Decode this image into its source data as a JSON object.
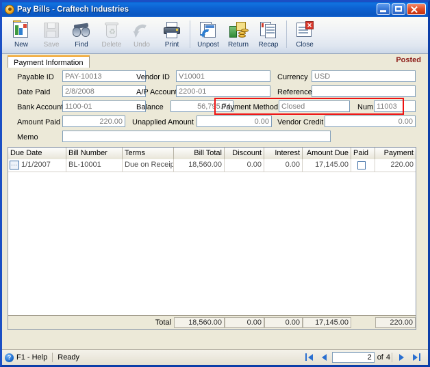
{
  "window": {
    "title": "Pay Bills - Craftech Industries",
    "icon": "app-icon",
    "caption_buttons": [
      "minimize",
      "maximize",
      "close"
    ]
  },
  "toolbar": {
    "items": [
      {
        "label": "New",
        "icon": "new-document-icon",
        "disabled": false
      },
      {
        "label": "Save",
        "icon": "save-floppy-icon",
        "disabled": true
      },
      {
        "label": "Find",
        "icon": "binoculars-icon",
        "disabled": false
      },
      {
        "label": "Delete",
        "icon": "recycle-bin-icon",
        "disabled": true
      },
      {
        "label": "Undo",
        "icon": "undo-arrow-icon",
        "disabled": true
      },
      {
        "label": "Print",
        "icon": "printer-icon",
        "disabled": false
      },
      {
        "label": "Unpost",
        "icon": "unpost-icon",
        "disabled": false
      },
      {
        "label": "Return",
        "icon": "return-money-icon",
        "disabled": false
      },
      {
        "label": "Recap",
        "icon": "recap-documents-icon",
        "disabled": false
      },
      {
        "label": "Close",
        "icon": "close-window-icon",
        "disabled": false
      }
    ]
  },
  "tabs": {
    "active": "Payment Information",
    "items": [
      "Payment Information"
    ]
  },
  "status_label": "Posted",
  "form": {
    "payable_id": {
      "label": "Payable ID",
      "value": "PAY-10013"
    },
    "date_paid": {
      "label": "Date Paid",
      "value": "2/8/2008"
    },
    "bank_account": {
      "label": "Bank Account",
      "value": "1100-01"
    },
    "amount_paid": {
      "label": "Amount Paid",
      "value": "220.00"
    },
    "memo": {
      "label": "Memo",
      "value": ""
    },
    "vendor_id": {
      "label": "Vendor ID",
      "value": "V10001"
    },
    "ap_account": {
      "label": "A/P Account",
      "value": "2200-01"
    },
    "balance": {
      "label": "Balance",
      "value": "56,795.74"
    },
    "unapplied_amount": {
      "label": "Unapplied Amount",
      "value": "0.00"
    },
    "currency": {
      "label": "Currency",
      "value": "USD"
    },
    "reference": {
      "label": "Reference",
      "value": ""
    },
    "payment_method": {
      "label": "Payment Method",
      "value": "Closed"
    },
    "num": {
      "label": "Num",
      "value": "11003"
    },
    "vendor_credit": {
      "label": "Vendor Credit",
      "value": "0.00"
    }
  },
  "highlight": {
    "color": "#ee1111",
    "target": "payment-method-and-num"
  },
  "grid": {
    "columns": [
      {
        "key": "due_date",
        "label": "Due Date",
        "align": "left"
      },
      {
        "key": "bill_number",
        "label": "Bill Number",
        "align": "left"
      },
      {
        "key": "terms",
        "label": "Terms",
        "align": "left"
      },
      {
        "key": "bill_total",
        "label": "Bill Total",
        "align": "right"
      },
      {
        "key": "discount",
        "label": "Discount",
        "align": "right"
      },
      {
        "key": "interest",
        "label": "Interest",
        "align": "right"
      },
      {
        "key": "amount_due",
        "label": "Amount Due",
        "align": "right"
      },
      {
        "key": "paid",
        "label": "Paid",
        "align": "left"
      },
      {
        "key": "payment",
        "label": "Payment",
        "align": "right"
      }
    ],
    "rows": [
      {
        "due_date": "1/1/2007",
        "bill_number": "BL-10001",
        "terms": "Due on Receip",
        "bill_total": "18,560.00",
        "discount": "0.00",
        "interest": "0.00",
        "amount_due": "17,145.00",
        "paid": false,
        "payment": "220.00"
      }
    ],
    "total": {
      "label": "Total",
      "bill_total": "18,560.00",
      "discount": "0.00",
      "interest": "0.00",
      "amount_due": "17,145.00",
      "payment": "220.00"
    }
  },
  "statusbar": {
    "help": "F1 - Help",
    "message": "Ready",
    "nav": {
      "current": "2",
      "of_label": "of",
      "total": "4",
      "first": "first-record",
      "prev": "previous-record",
      "next": "next-record",
      "last": "last-record"
    }
  }
}
